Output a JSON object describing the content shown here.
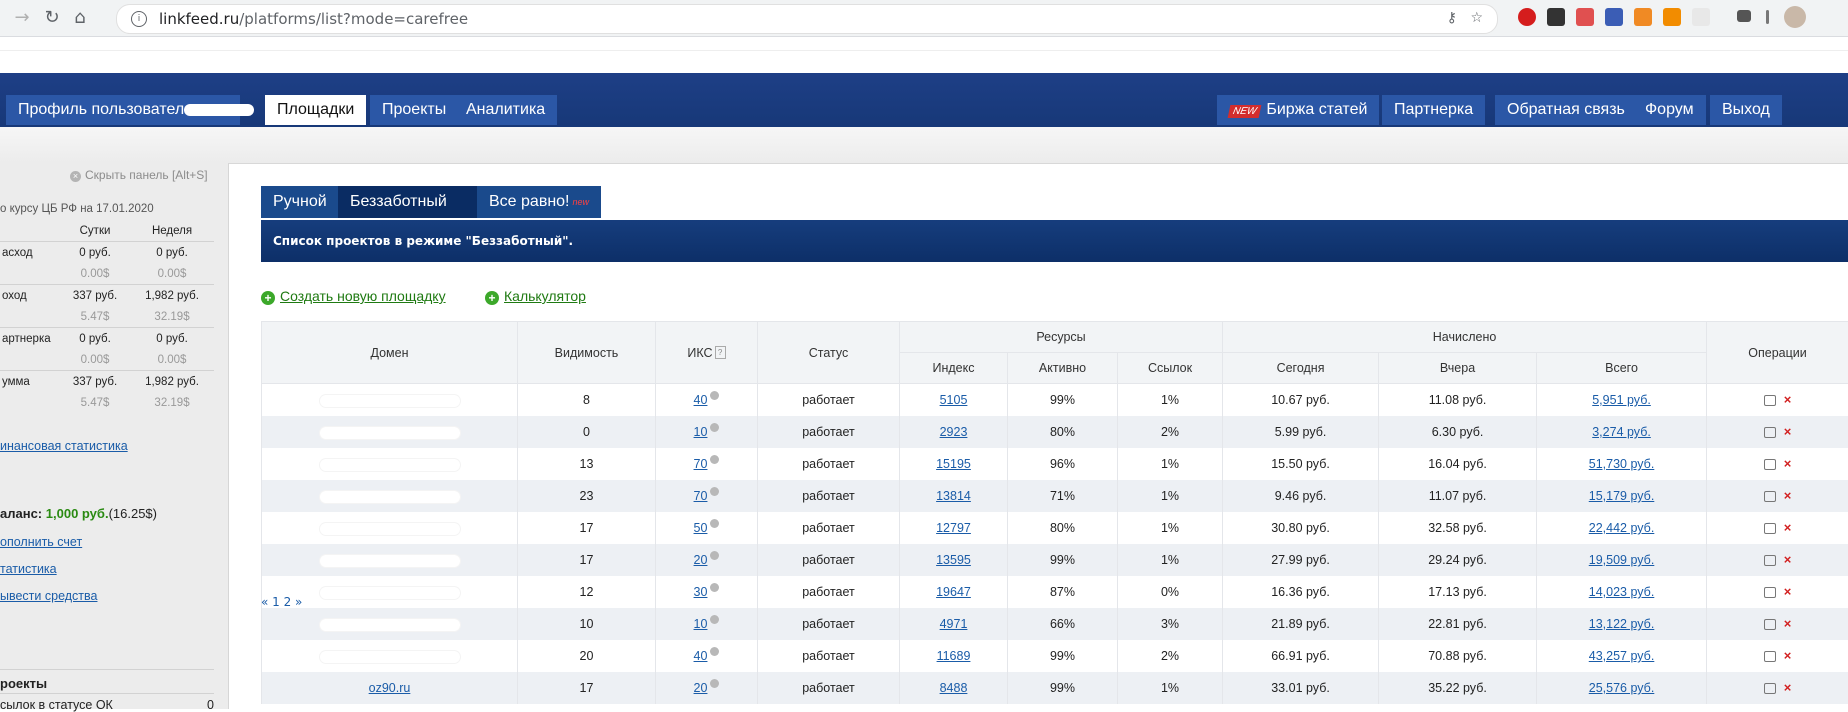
{
  "browser": {
    "url_host": "linkfeed.ru",
    "url_path": "/platforms/list?mode=carefree"
  },
  "site_nav": {
    "left": [
      {
        "label": "Профиль пользовател"
      },
      {
        "label": "Площадки"
      },
      {
        "label": "Проекты"
      },
      {
        "label": "Аналитика"
      }
    ],
    "right": [
      {
        "badge": "NEW",
        "label": "Биржа статей"
      },
      {
        "label": "Партнерка"
      },
      {
        "label": "Обратная связь"
      },
      {
        "label": "Форум"
      },
      {
        "label": "Выход"
      }
    ]
  },
  "left_panel": {
    "hide_panel": "Скрыть панель [Alt+S]",
    "rate_title": "о курсу ЦБ РФ на 17.01.2020",
    "col_day": "Сутки",
    "col_week": "Неделя",
    "rows": [
      {
        "label": "асход",
        "day": "0 руб.",
        "day_usd": "0.00$",
        "week": "0 руб.",
        "week_usd": "0.00$"
      },
      {
        "label": "оход",
        "day": "337 руб.",
        "day_usd": "5.47$",
        "week": "1,982 руб.",
        "week_usd": "32.19$"
      },
      {
        "label": "артнерка",
        "day": "0 руб.",
        "day_usd": "0.00$",
        "week": "0 руб.",
        "week_usd": "0.00$"
      },
      {
        "label": "умма",
        "day": "337 руб.",
        "day_usd": "5.47$",
        "week": "1,982 руб.",
        "week_usd": "32.19$"
      }
    ],
    "fin_stats": "инансовая статистика",
    "balance_label": "аланс:",
    "balance_amount": "1,000 руб.",
    "balance_usd": "(16.25$)",
    "link_topup": "ополнить счет",
    "link_stats": "татистика",
    "link_withdraw": "ывести средства",
    "projects_header": "роекты",
    "ok_label": "сылок в статусе ОК",
    "ok_count": "0"
  },
  "main": {
    "tabs": [
      {
        "label": "Ручной"
      },
      {
        "label": "Беззаботный"
      },
      {
        "label": "Все равно!",
        "sup": "new"
      }
    ],
    "info": "Список проектов в режиме \"Беззаботный\".",
    "create_link": "Создать новую площадку",
    "calc_link": "Калькулятор",
    "headers": {
      "domain": "Домен",
      "visibility": "Видимость",
      "iks": "ИКС",
      "status": "Статус",
      "resources": "Ресурсы",
      "index": "Индекс",
      "active": "Активно",
      "links": "Ссылок",
      "accrued": "Начислено",
      "today": "Сегодня",
      "yesterday": "Вчера",
      "total": "Всего",
      "ops": "Операции"
    },
    "rows": [
      {
        "domain": "",
        "vis": "8",
        "iks": "40",
        "status": "работает",
        "index": "5105",
        "active": "99%",
        "links": "1%",
        "today": "10.67 руб.",
        "yesterday": "11.08 руб.",
        "total": "5,951 руб."
      },
      {
        "domain": "",
        "vis": "0",
        "iks": "10",
        "status": "работает",
        "index": "2923",
        "active": "80%",
        "links": "2%",
        "today": "5.99 руб.",
        "yesterday": "6.30 руб.",
        "total": "3,274 руб."
      },
      {
        "domain": "",
        "vis": "13",
        "iks": "70",
        "status": "работает",
        "index": "15195",
        "active": "96%",
        "links": "1%",
        "today": "15.50 руб.",
        "yesterday": "16.04 руб.",
        "total": "51,730 руб."
      },
      {
        "domain": "",
        "vis": "23",
        "iks": "70",
        "status": "работает",
        "index": "13814",
        "active": "71%",
        "links": "1%",
        "today": "9.46 руб.",
        "yesterday": "11.07 руб.",
        "total": "15,179 руб."
      },
      {
        "domain": "",
        "vis": "17",
        "iks": "50",
        "status": "работает",
        "index": "12797",
        "active": "80%",
        "links": "1%",
        "today": "30.80 руб.",
        "yesterday": "32.58 руб.",
        "total": "22,442 руб."
      },
      {
        "domain": "",
        "vis": "17",
        "iks": "20",
        "status": "работает",
        "index": "13595",
        "active": "99%",
        "links": "1%",
        "today": "27.99 руб.",
        "yesterday": "29.24 руб.",
        "total": "19,509 руб."
      },
      {
        "domain": "",
        "vis": "12",
        "iks": "30",
        "status": "работает",
        "index": "19647",
        "active": "87%",
        "links": "0%",
        "today": "16.36 руб.",
        "yesterday": "17.13 руб.",
        "total": "14,023 руб."
      },
      {
        "domain": "",
        "vis": "10",
        "iks": "10",
        "status": "работает",
        "index": "4971",
        "active": "66%",
        "links": "3%",
        "today": "21.89 руб.",
        "yesterday": "22.81 руб.",
        "total": "13,122 руб."
      },
      {
        "domain": "",
        "vis": "20",
        "iks": "40",
        "status": "работает",
        "index": "11689",
        "active": "99%",
        "links": "2%",
        "today": "66.91 руб.",
        "yesterday": "70.88 руб.",
        "total": "43,257 руб."
      },
      {
        "domain": "oz90.ru",
        "vis": "17",
        "iks": "20",
        "status": "работает",
        "index": "8488",
        "active": "99%",
        "links": "1%",
        "today": "33.01 руб.",
        "yesterday": "35.22 руб.",
        "total": "25,576 руб."
      }
    ],
    "pager": "« 1 2 »"
  }
}
